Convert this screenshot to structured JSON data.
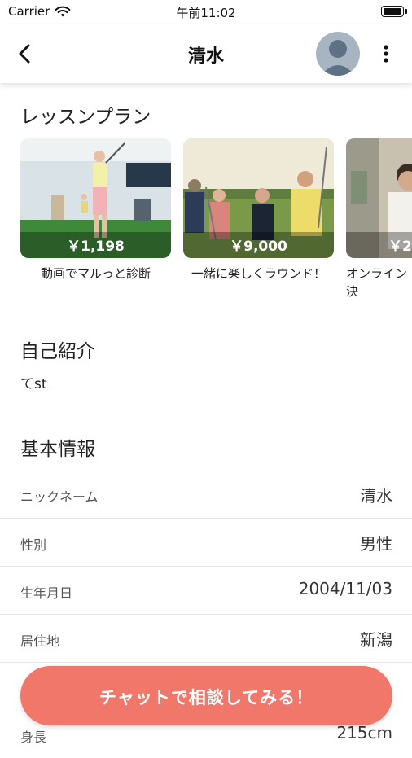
{
  "status_bar": {
    "carrier": "Carrier",
    "time": "午前11:02"
  },
  "nav": {
    "title": "清水"
  },
  "lesson_plans": {
    "heading": "レッスンプラン",
    "items": [
      {
        "price": "￥1,198",
        "name": "動画でマルっと診断"
      },
      {
        "price": "￥9,000",
        "name": "一緒に楽しくラウンド！"
      },
      {
        "price": "￥2",
        "name": "オンライン決"
      }
    ]
  },
  "self_intro": {
    "heading": "自己紹介",
    "text": "てst"
  },
  "basic_info": {
    "heading": "基本情報",
    "rows": [
      {
        "label": "ニックネーム",
        "value": "清水"
      },
      {
        "label": "性別",
        "value": "男性"
      },
      {
        "label": "生年月日",
        "value": "2004/11/03"
      },
      {
        "label": "居住地",
        "value": "新潟"
      },
      {
        "label": "身長",
        "value": "215cm"
      }
    ]
  },
  "cta": {
    "label": "チャットで相談してみる！"
  },
  "colors": {
    "accent": "#f2776b"
  }
}
